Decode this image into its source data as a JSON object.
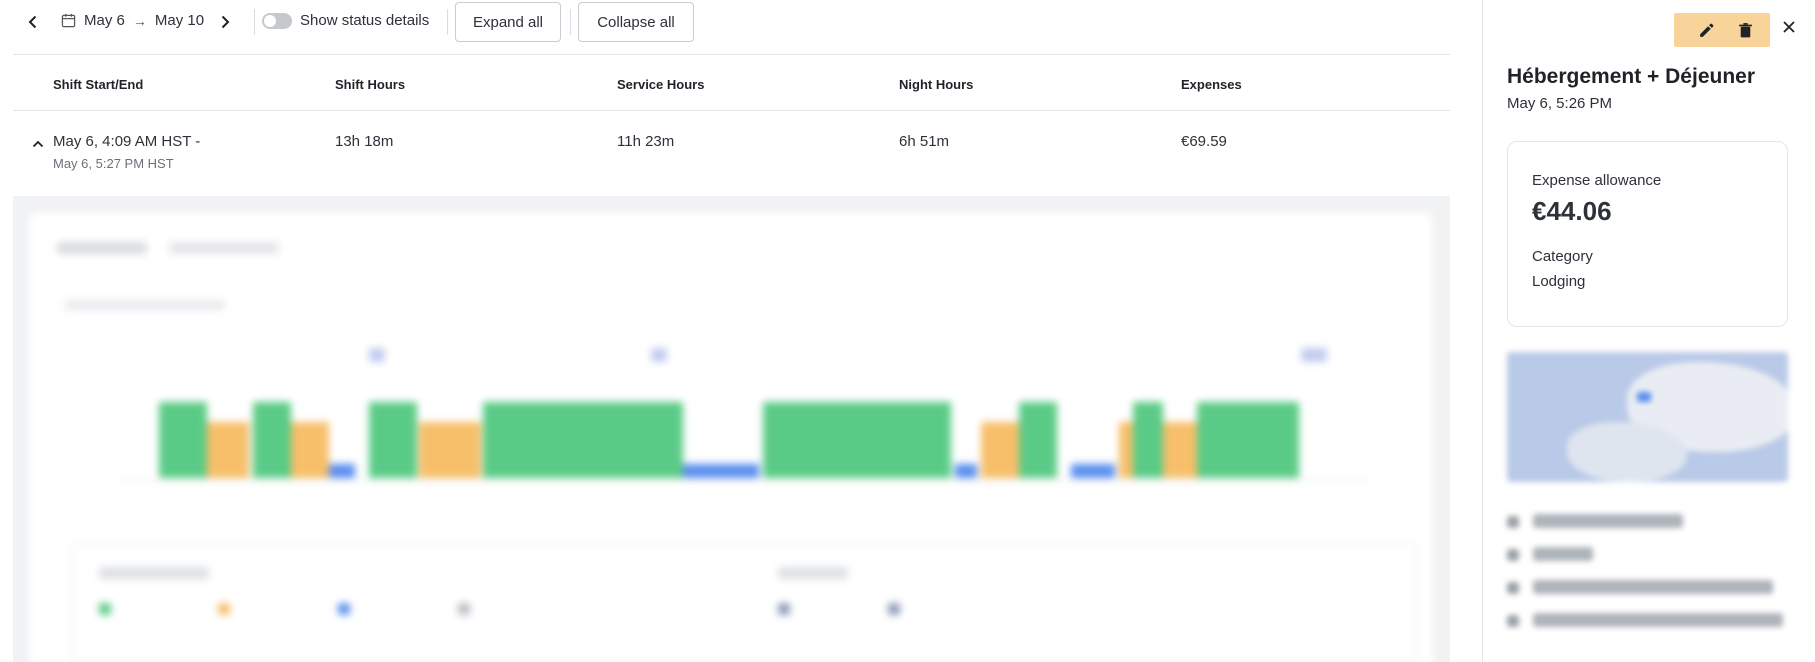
{
  "toolbar": {
    "date_start": "May 6",
    "date_end": "May 10",
    "arrow": "→",
    "show_status_details_label": "Show status details",
    "expand_all_label": "Expand all",
    "collapse_all_label": "Collapse all",
    "show_status_details_on": false
  },
  "table": {
    "headers": [
      "Shift Start/End",
      "Shift Hours",
      "Service Hours",
      "Night Hours",
      "Expenses"
    ],
    "rows": [
      {
        "shift_start_end": "May 6, 4:09 AM HST -",
        "shift_end": "May 6, 5:27 PM HST",
        "shift_hours": "13h 18m",
        "service_hours": "11h 23m",
        "night_hours": "6h 51m",
        "expenses": "€69.59",
        "expanded": true
      }
    ]
  },
  "colors": {
    "driving": "#5acb86",
    "waiting": "#f7bf6a",
    "resting": "#5a8ef0",
    "side_actions_bg": "#f9d49a"
  },
  "icons": [
    "chevron-left-icon",
    "chevron-right-icon",
    "calendar-icon",
    "chevron-up-icon",
    "pencil-icon",
    "trash-icon",
    "close-icon"
  ],
  "side_panel": {
    "title": "Hébergement + Déjeuner",
    "date": "May 6, 5:26 PM",
    "card": {
      "allowance_label": "Expense allowance",
      "allowance_amount": "€44.06",
      "category_label": "Category",
      "category_value": "Lodging"
    }
  }
}
